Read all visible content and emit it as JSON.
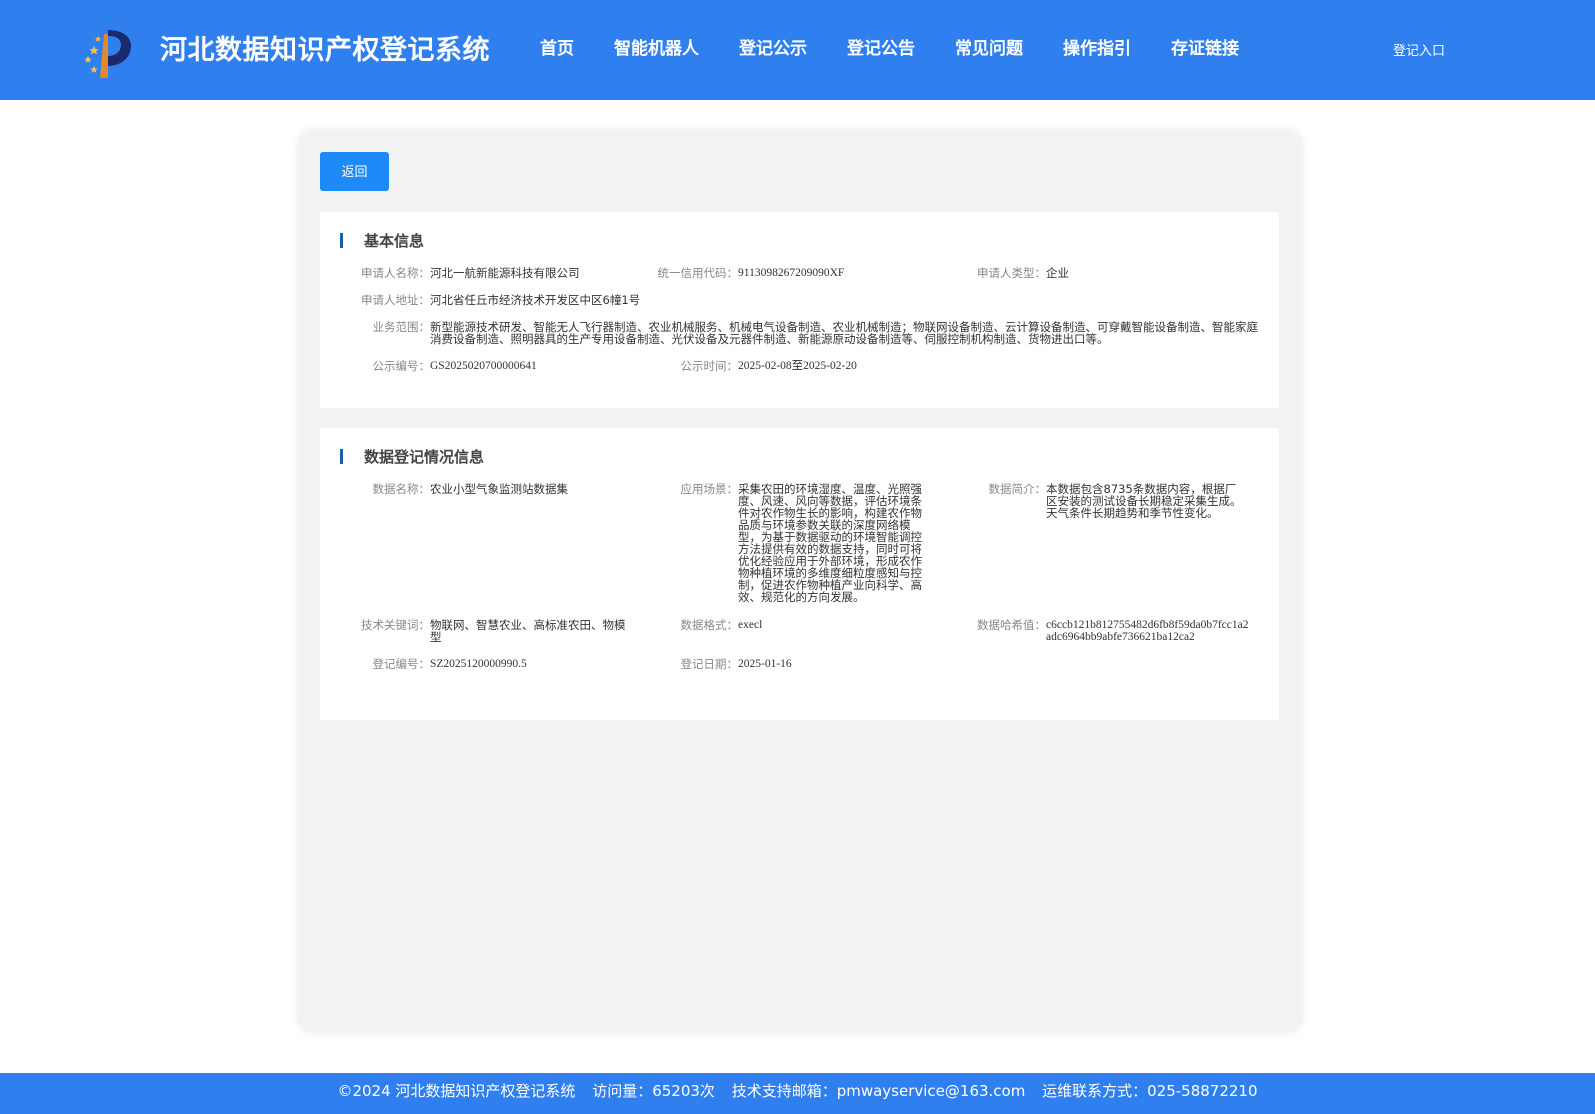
{
  "header": {
    "site_title": "河北数据知识产权登记系统",
    "nav": [
      "首页",
      "智能机器人",
      "登记公示",
      "登记公告",
      "常见问题",
      "操作指引",
      "存证链接"
    ],
    "login": "登记入口"
  },
  "back_label": "返回",
  "basic": {
    "title": "基本信息",
    "applicant_name_label": "申请人名称：",
    "applicant_name": "河北一航新能源科技有限公司",
    "credit_code_label": "统一信用代码：",
    "credit_code": "9113098267209090XF",
    "applicant_type_label": "申请人类型：",
    "applicant_type": "企业",
    "address_label": "申请人地址：",
    "address": "河北省任丘市经济技术开发区中区6幢1号",
    "scope_label": "业务范围：",
    "scope": "新型能源技术研发、智能无人飞行器制造、农业机械服务、机械电气设备制造、农业机械制造；物联网设备制造、云计算设备制造、可穿戴智能设备制造、智能家庭消费设备制造、照明器具的生产专用设备制造、光伏设备及元器件制造、新能源原动设备制造等、伺服控制机构制造、货物进出口等。",
    "pub_no_label": "公示编号：",
    "pub_no": "GS2025020700000641",
    "pub_time_label": "公示时间：",
    "pub_time": "2025-02-08至2025-02-20"
  },
  "data": {
    "title": "数据登记情况信息",
    "name_label": "数据名称：",
    "name": "农业小型气象监测站数据集",
    "scene_label": "应用场景：",
    "scene": "采集农田的环境湿度、温度、光照强度、风速、风向等数据，评估环境条件对农作物生长的影响，构建农作物品质与环境参数关联的深度网络模型，为基于数据驱动的环境智能调控方法提供有效的数据支持，同时可将优化经验应用于外部环境，形成农作物种植环境的多维度细粒度感知与控制，促进农作物种植产业向科学、高效、规范化的方向发展。",
    "intro_label": "数据简介：",
    "intro": "本数据包含8735条数据内容，根据厂区安装的测试设备长期稳定采集生成。天气条件长期趋势和季节性变化。",
    "keywords_label": "技术关键词：",
    "keywords": "物联网、智慧农业、高标准农田、物模型",
    "format_label": "数据格式：",
    "format": "execl",
    "hash_label": "数据哈希值：",
    "hash": "c6ccb121b812755482d6fb8f59da0b7fcc1a2adc6964bb9abfe736621ba12ca2",
    "reg_no_label": "登记编号：",
    "reg_no": "SZ2025120000990.5",
    "reg_date_label": "登记日期：",
    "reg_date": "2025-01-16"
  },
  "footer": {
    "copyright": "©2024 河北数据知识产权登记系统",
    "visits": "访问量：65203次",
    "email": "技术支持邮箱：pmwayservice@163.com",
    "phone": "运维联系方式：025-58872210"
  },
  "colors": {
    "header_bg": "#2f7fef",
    "button_bg": "#1e8af7",
    "title_bar": "#1e5fa8",
    "panel_bg": "#f2f2f2"
  }
}
